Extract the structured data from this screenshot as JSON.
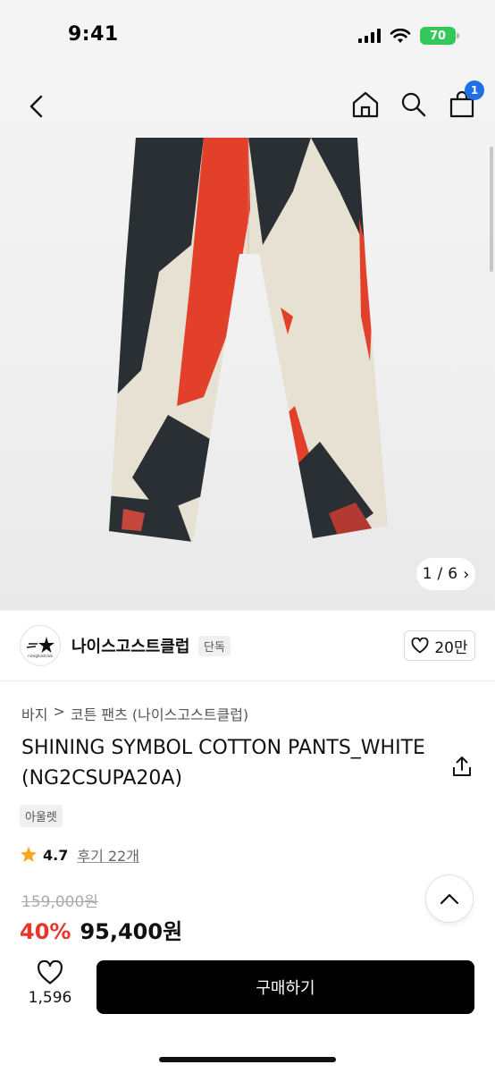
{
  "status_bar": {
    "time": "9:41",
    "battery": "70"
  },
  "nav": {
    "cart_count": "1"
  },
  "gallery": {
    "current": "1",
    "separator": "/",
    "total": "6",
    "next_glyph": "›"
  },
  "brand": {
    "name": "나이스고스트클럽",
    "tag": "단독",
    "like_count": "20만",
    "logo_small_text": "niceghostclub"
  },
  "breadcrumb": {
    "category": "바지",
    "separator": ">",
    "subcategory": "코튼 팬츠 (나이스고스트클럽)"
  },
  "product": {
    "title": "SHINING SYMBOL COTTON PANTS_WHITE(NG2CSUPA20A)",
    "outlet_badge": "아울렛",
    "rating": "4.7",
    "reviews_label": "후기 22개",
    "original_price": "159,000원",
    "discount": "40%",
    "sale_price": "95,400원"
  },
  "bottom_bar": {
    "wish_count": "1,596",
    "buy_label": "구매하기"
  },
  "colors": {
    "accent_blue": "#1f6fe5",
    "discount_red": "#e8342a",
    "battery_green": "#34c759",
    "star": "#f5a623"
  }
}
